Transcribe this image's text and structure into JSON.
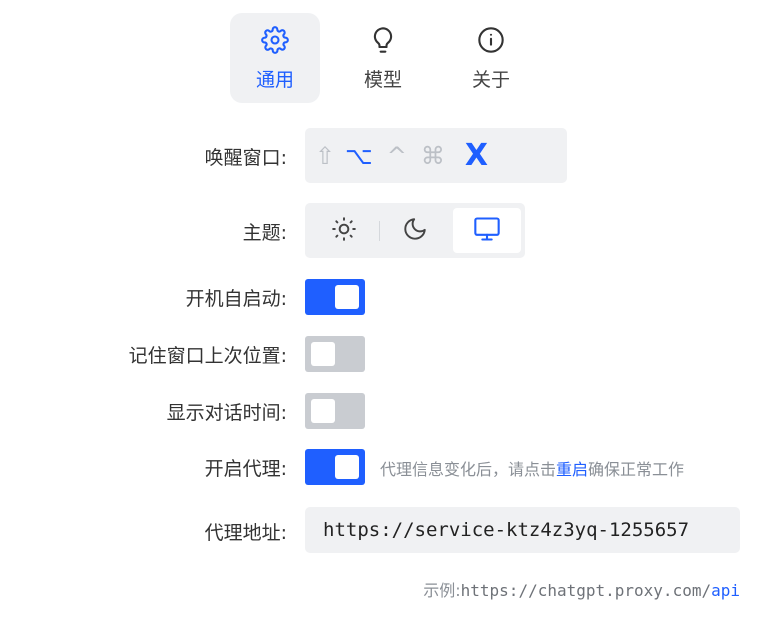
{
  "tabs": [
    {
      "label": "通用",
      "icon": "gear-icon",
      "active": true
    },
    {
      "label": "模型",
      "icon": "lightbulb-icon",
      "active": false
    },
    {
      "label": "关于",
      "icon": "info-icon",
      "active": false
    }
  ],
  "settings": {
    "hotkey": {
      "label": "唤醒窗口:",
      "keys": [
        "⇧",
        "⌥",
        "^",
        "⌘",
        "X"
      ]
    },
    "theme": {
      "label": "主题:",
      "options": [
        "sun-icon",
        "moon-icon",
        "monitor-icon"
      ],
      "selected": "monitor-icon"
    },
    "autostart": {
      "label": "开机自启动:",
      "enabled": true
    },
    "remember_position": {
      "label": "记住窗口上次位置:",
      "enabled": false
    },
    "show_time": {
      "label": "显示对话时间:",
      "enabled": false
    },
    "proxy": {
      "label": "开启代理:",
      "enabled": true,
      "hint_prefix": "代理信息变化后，请点击",
      "hint_link": "重启",
      "hint_suffix": "确保正常工作"
    },
    "proxy_address": {
      "label": "代理地址:",
      "value": "https://service-ktz4z3yq-1255657",
      "example_label": "示例:",
      "example_url_prefix": "https://chatgpt.proxy.com/",
      "example_url_highlight": "api"
    }
  },
  "colors": {
    "accent": "#1f5fff",
    "panel_bg": "#f0f1f3",
    "toggle_off": "#c9ccd1"
  }
}
